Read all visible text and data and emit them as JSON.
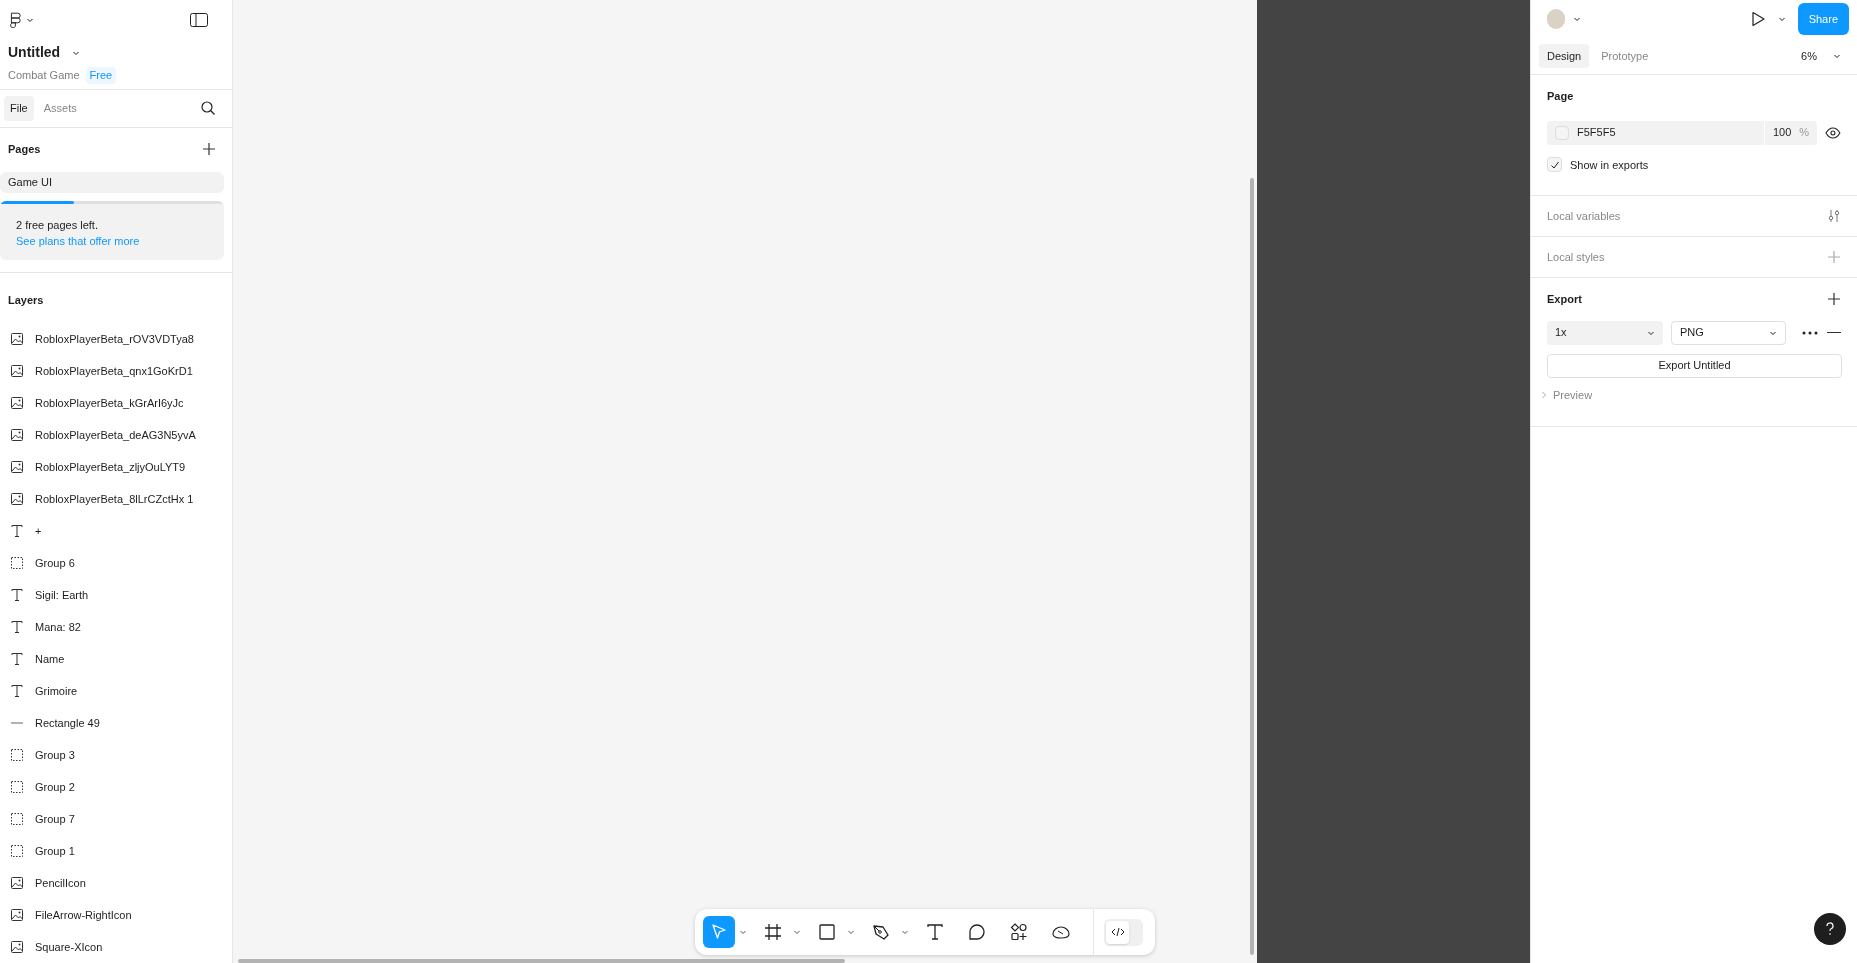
{
  "file": {
    "title": "Untitled",
    "project": "Combat Game",
    "plan": "Free"
  },
  "left_tabs": [
    {
      "label": "File",
      "selected": true
    },
    {
      "label": "Assets",
      "selected": false
    }
  ],
  "pages": {
    "heading": "Pages",
    "items": [
      {
        "label": "Game UI",
        "selected": true
      }
    ]
  },
  "page_limit": {
    "level": 0.33,
    "message": "2 free pages left.",
    "link": "See plans that offer more"
  },
  "layers": {
    "heading": "Layers",
    "items": [
      {
        "kind": "image",
        "name": "RobloxPlayerBeta_rOV3VDTya8"
      },
      {
        "kind": "image",
        "name": "RobloxPlayerBeta_qnx1GoKrD1"
      },
      {
        "kind": "image",
        "name": "RobloxPlayerBeta_kGrArI6yJc"
      },
      {
        "kind": "image",
        "name": "RobloxPlayerBeta_deAG3N5yvA"
      },
      {
        "kind": "image",
        "name": "RobloxPlayerBeta_zljyOuLYT9"
      },
      {
        "kind": "image",
        "name": "RobloxPlayerBeta_8lLrCZctHx 1"
      },
      {
        "kind": "text",
        "name": "+"
      },
      {
        "kind": "group",
        "name": "Group 6"
      },
      {
        "kind": "text",
        "name": "Sigil: Earth"
      },
      {
        "kind": "text",
        "name": "Mana: 82"
      },
      {
        "kind": "text",
        "name": "Name"
      },
      {
        "kind": "text",
        "name": "Grimoire"
      },
      {
        "kind": "line",
        "name": "Rectangle 49"
      },
      {
        "kind": "group",
        "name": "Group 3"
      },
      {
        "kind": "group",
        "name": "Group 2"
      },
      {
        "kind": "group",
        "name": "Group 7"
      },
      {
        "kind": "group",
        "name": "Group 1"
      },
      {
        "kind": "image",
        "name": "PencilIcon"
      },
      {
        "kind": "image",
        "name": "FileArrow-RightIcon"
      },
      {
        "kind": "image",
        "name": "Square-XIcon"
      }
    ]
  },
  "toolbar": {
    "tools": [
      {
        "kind": "move",
        "selected": true,
        "menu": true
      },
      {
        "kind": "frame",
        "selected": false,
        "menu": true
      },
      {
        "kind": "rectangle",
        "selected": false,
        "menu": true
      },
      {
        "kind": "pen",
        "selected": false,
        "menu": true
      },
      {
        "kind": "text",
        "selected": false,
        "menu": false
      },
      {
        "kind": "comment",
        "selected": false,
        "menu": false
      },
      {
        "kind": "actions",
        "selected": false,
        "menu": false
      },
      {
        "kind": "cloud",
        "selected": false,
        "menu": false
      }
    ],
    "dev_mode": {
      "on": false
    }
  },
  "right_header": {
    "share": "Share"
  },
  "right_tabs": [
    {
      "label": "Design",
      "selected": true
    },
    {
      "label": "Prototype",
      "selected": false
    }
  ],
  "zoom": "6%",
  "page_section": {
    "heading": "Page",
    "color": "F5F5F5",
    "opacity": "100",
    "unit": "%",
    "show_in_exports": {
      "label": "Show in exports",
      "checked": true
    }
  },
  "local_variables": "Local variables",
  "local_styles": "Local styles",
  "export": {
    "heading": "Export",
    "scale": "1x",
    "format": "PNG",
    "button": "Export Untitled",
    "preview": "Preview"
  }
}
